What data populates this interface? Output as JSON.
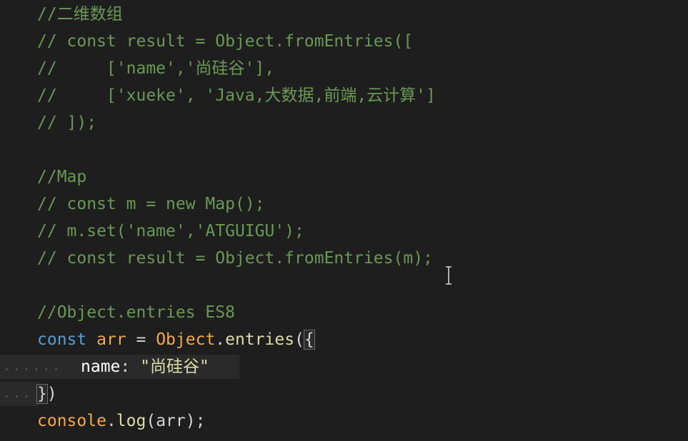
{
  "code": {
    "l1": "//二维数组",
    "l2": "// const result = Object.fromEntries([",
    "l3": "//     ['name','尚硅谷'],",
    "l4": "//     ['xueke', 'Java,大数据,前端,云计算']",
    "l5": "// ]);",
    "l7": "//Map",
    "l8": "// const m = new Map();",
    "l9": "// m.set('name','ATGUIGU');",
    "l10": "// const result = Object.fromEntries(m);",
    "l12": "//Object.entries ES8",
    "l13": {
      "kw": "const",
      "var": "arr",
      "eq": " = ",
      "obj": "Object",
      "dot": ".",
      "fn": "entries",
      "open": "(",
      "brace": "{"
    },
    "l14": {
      "prop": "name",
      "colon": ": ",
      "str": "\"尚硅谷\""
    },
    "l15": {
      "brace": "}",
      "close": ")"
    },
    "l16": {
      "obj": "console",
      "dot": ".",
      "fn": "log",
      "args": "(arr);"
    }
  },
  "gutter": {
    "dots_14": "......",
    "dots_15": "..."
  },
  "colors": {
    "background": "#1e1e1e",
    "comment": "#6a9955",
    "keyword": "#569cd6",
    "variable": "#f4a84a",
    "function": "#dcdcaa"
  }
}
